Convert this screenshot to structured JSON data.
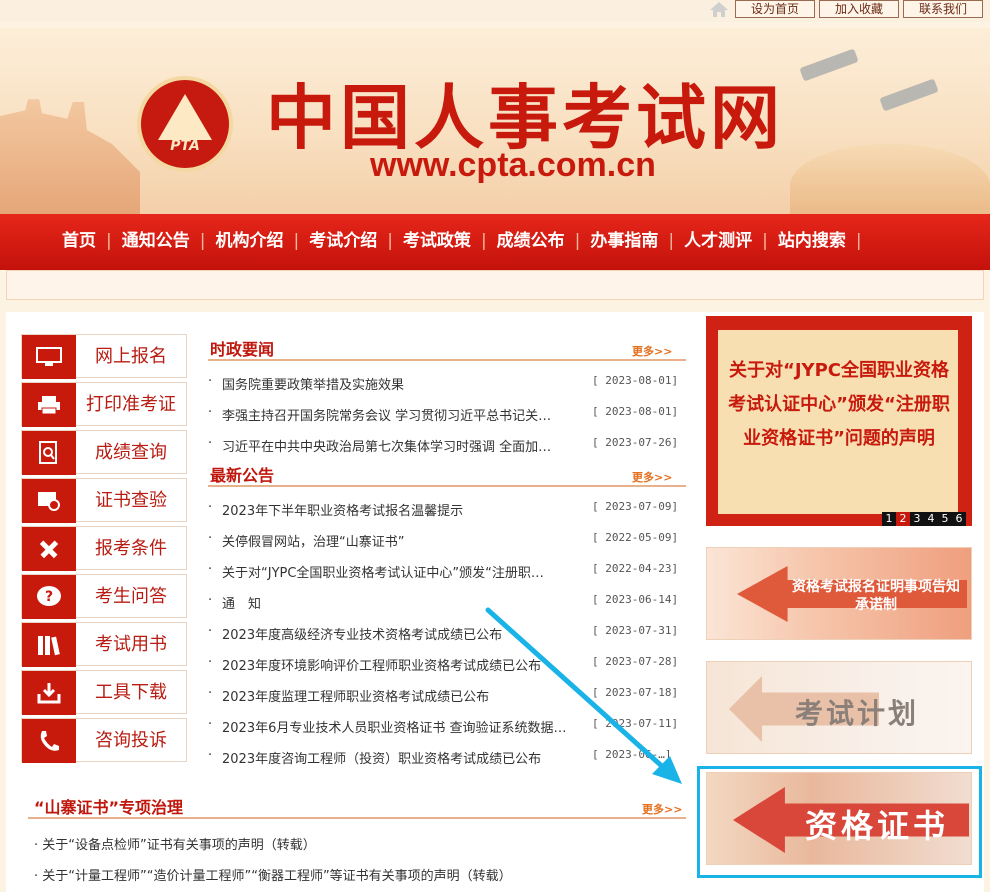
{
  "topbar": {
    "buttons": [
      "设为首页",
      "加入收藏",
      "联系我们"
    ]
  },
  "header": {
    "logo_text": "PTA",
    "title": "中国人事考试网",
    "url": "www.cpta.com.cn"
  },
  "nav": {
    "items": [
      "首页",
      "通知公告",
      "机构介绍",
      "考试介绍",
      "考试政策",
      "成绩公布",
      "办事指南",
      "人才测评",
      "站内搜索"
    ]
  },
  "quick_links": [
    {
      "label": "网上报名",
      "icon": "monitor-icon"
    },
    {
      "label": "打印准考证",
      "icon": "printer-icon"
    },
    {
      "label": "成绩查询",
      "icon": "document-search-icon"
    },
    {
      "label": "证书查验",
      "icon": "certificate-search-icon"
    },
    {
      "label": "报考条件",
      "icon": "pencil-ruler-icon"
    },
    {
      "label": "考生问答",
      "icon": "question-icon"
    },
    {
      "label": "考试用书",
      "icon": "books-icon"
    },
    {
      "label": "工具下载",
      "icon": "download-tray-icon"
    },
    {
      "label": "咨询投诉",
      "icon": "phone-icon"
    }
  ],
  "news": {
    "title": "时政要闻",
    "more": "更多>>",
    "items": [
      {
        "text": "国务院重要政策举措及实施效果",
        "date": "[ 2023-08-01]"
      },
      {
        "text": "李强主持召开国务院常务会议 学习贯彻习近平总书记关…",
        "date": "[ 2023-08-01]"
      },
      {
        "text": "习近平在中共中央政治局第七次集体学习时强调 全面加…",
        "date": "[ 2023-07-26]"
      }
    ]
  },
  "notices": {
    "title": "最新公告",
    "more": "更多>>",
    "items": [
      {
        "text": "2023年下半年职业资格考试报名温馨提示",
        "date": "[ 2023-07-09]"
      },
      {
        "text": "关停假冒网站，治理“山寨证书”",
        "date": "[ 2022-05-09]"
      },
      {
        "text": "关于对“JYPC全国职业资格考试认证中心”颁发“注册职…",
        "date": "[ 2022-04-23]"
      },
      {
        "text": "通　知",
        "date": "[ 2023-06-14]"
      },
      {
        "text": "2023年度高级经济专业技术资格考试成绩已公布",
        "date": "[ 2023-07-31]"
      },
      {
        "text": "2023年度环境影响评价工程师职业资格考试成绩已公布",
        "date": "[ 2023-07-28]"
      },
      {
        "text": "2023年度监理工程师职业资格考试成绩已公布",
        "date": "[ 2023-07-18]"
      },
      {
        "text": "2023年6月专业技术人员职业资格证书 查询验证系统数据…",
        "date": "[ 2023-07-11]"
      },
      {
        "text": "2023年度咨询工程师（投资）职业资格考试成绩已公布",
        "date": "[ 2023-06-…]"
      }
    ]
  },
  "fake_certs": {
    "title": "“山寨证书”专项治理",
    "more": "更多>>",
    "items": [
      "关于“设备点检师”证书有关事项的声明（转载）",
      "关于“计量工程师”“造价计量工程师”“衡器工程师”等证书有关事项的声明（转载）"
    ]
  },
  "promo": {
    "text": "关于对“JYPC全国职业资格考试认证中心”颁发“注册职业资格证书”问题的声明",
    "pages": [
      "1",
      "2",
      "3",
      "4",
      "5",
      "6"
    ],
    "active_page": "2"
  },
  "banners": {
    "b1": "资格考试报名证明事项告知承诺制",
    "b2": "考试计划",
    "b3": "资格证书"
  },
  "colors": {
    "brand_red": "#c8190d",
    "highlight_blue": "#19b3e8"
  }
}
